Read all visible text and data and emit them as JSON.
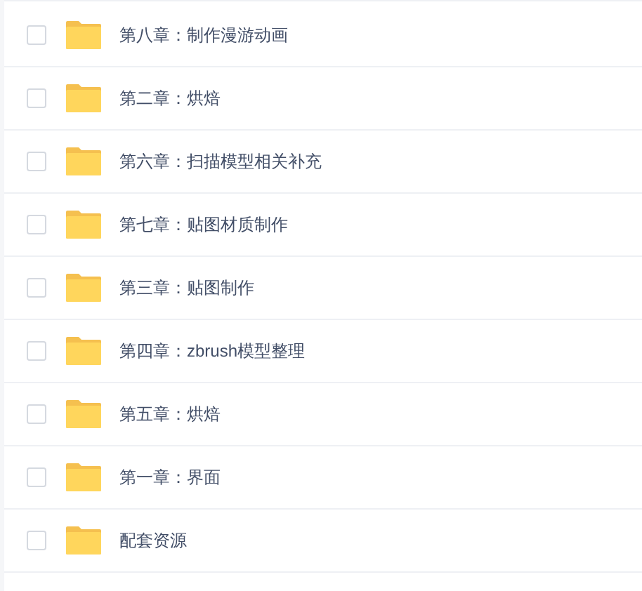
{
  "files": [
    {
      "name": "第八章：制作漫游动画",
      "checked": false
    },
    {
      "name": "第二章：烘焙",
      "checked": false
    },
    {
      "name": "第六章：扫描模型相关补充",
      "checked": false
    },
    {
      "name": "第七章：贴图材质制作",
      "checked": false
    },
    {
      "name": "第三章：贴图制作",
      "checked": false
    },
    {
      "name": "第四章：zbrush模型整理",
      "checked": false
    },
    {
      "name": "第五章：烘焙",
      "checked": false
    },
    {
      "name": "第一章：界面",
      "checked": false
    },
    {
      "name": "配套资源",
      "checked": false
    }
  ]
}
